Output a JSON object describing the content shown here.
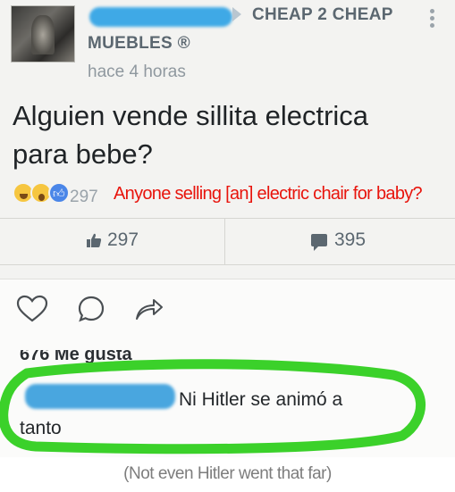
{
  "post": {
    "page_name": "CHEAP 2 CHEAP",
    "group_name": "MUEBLES ®",
    "timestamp": "hace 4 horas",
    "text_line1": "Alguien vende sillita electrica",
    "text_line2": "para bebe?",
    "reaction_count": "297",
    "like_count": "297",
    "comment_count": "395"
  },
  "actions": {
    "heart_icon": "heart-outline-icon",
    "comment_icon": "speech-bubble-icon",
    "share_icon": "share-arrow-icon",
    "likes_partial": "676 Me gusta"
  },
  "comment": {
    "line1": "Ni Hitler se animó a",
    "line2": "tanto"
  },
  "annotations": {
    "translation_post": "Anyone selling [an] electric chair for baby?",
    "translation_comment": "(Not even Hitler went that far)"
  },
  "colors": {
    "redaction_blue": "#3fa9e6",
    "highlight_green": "#3bd12a",
    "translation_red": "#e8140c"
  }
}
